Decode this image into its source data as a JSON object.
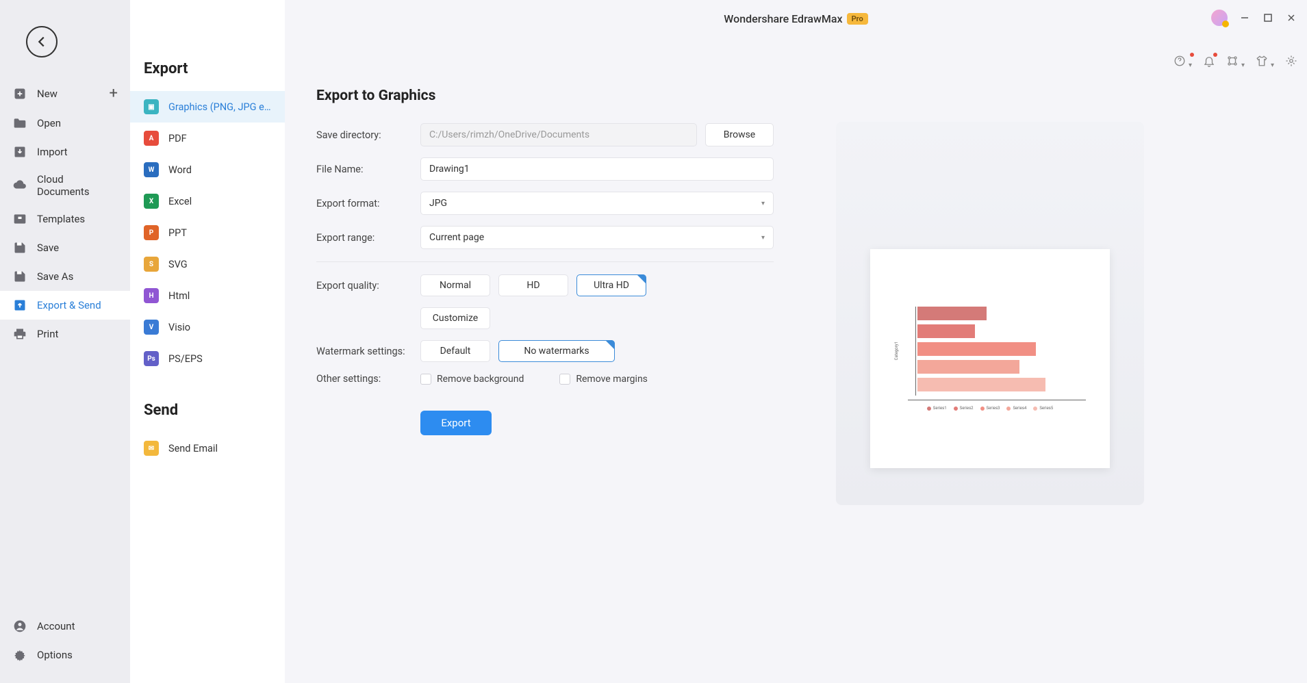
{
  "app": {
    "title": "Wondershare EdrawMax",
    "badge": "Pro"
  },
  "left_nav": {
    "items": [
      {
        "label": "New",
        "icon": "plus-square"
      },
      {
        "label": "Open",
        "icon": "folder"
      },
      {
        "label": "Import",
        "icon": "import"
      },
      {
        "label": "Cloud Documents",
        "icon": "cloud"
      },
      {
        "label": "Templates",
        "icon": "templates"
      },
      {
        "label": "Save",
        "icon": "save"
      },
      {
        "label": "Save As",
        "icon": "save-as"
      },
      {
        "label": "Export & Send",
        "icon": "export",
        "active": true
      },
      {
        "label": "Print",
        "icon": "print"
      }
    ],
    "bottom": [
      {
        "label": "Account",
        "icon": "account"
      },
      {
        "label": "Options",
        "icon": "gear"
      }
    ]
  },
  "subpanel": {
    "export_heading": "Export",
    "export_items": [
      {
        "label": "Graphics (PNG, JPG et...",
        "color": "#3bb4c1",
        "active": true
      },
      {
        "label": "PDF",
        "color": "#e74c3c"
      },
      {
        "label": "Word",
        "color": "#2a6dbf"
      },
      {
        "label": "Excel",
        "color": "#1f9a55"
      },
      {
        "label": "PPT",
        "color": "#e06428"
      },
      {
        "label": "SVG",
        "color": "#e8a63a"
      },
      {
        "label": "Html",
        "color": "#9056d3"
      },
      {
        "label": "Visio",
        "color": "#3a7bd5"
      },
      {
        "label": "PS/EPS",
        "color": "#6360c8"
      }
    ],
    "send_heading": "Send",
    "send_items": [
      {
        "label": "Send Email",
        "color": "#f3b83c"
      }
    ]
  },
  "form": {
    "heading": "Export to Graphics",
    "save_dir_label": "Save directory:",
    "save_dir_value": "C:/Users/rimzh/OneDrive/Documents",
    "browse": "Browse",
    "filename_label": "File Name:",
    "filename_value": "Drawing1",
    "format_label": "Export format:",
    "format_value": "JPG",
    "range_label": "Export range:",
    "range_value": "Current page",
    "quality_label": "Export quality:",
    "quality_options": {
      "normal": "Normal",
      "hd": "HD",
      "ultra": "Ultra HD",
      "customize": "Customize"
    },
    "watermark_label": "Watermark settings:",
    "watermark_options": {
      "default": "Default",
      "none": "No watermarks"
    },
    "other_label": "Other settings:",
    "remove_bg": "Remove background",
    "remove_margins": "Remove margins",
    "export_btn": "Export"
  },
  "chart_data": {
    "type": "bar",
    "orientation": "horizontal",
    "categories": [
      "Series1",
      "Series2",
      "Series3",
      "Series4",
      "Series5"
    ],
    "values": [
      42,
      35,
      72,
      62,
      78
    ],
    "colors": [
      "#d47a78",
      "#e27c78",
      "#f18f84",
      "#f3a79a",
      "#f6bcb1"
    ],
    "title": "",
    "xlabel": "",
    "ylabel": "Category1",
    "xlim": [
      0,
      100
    ],
    "legend_items": [
      "Series1",
      "Series2",
      "Series3",
      "Series4",
      "Series5"
    ]
  }
}
